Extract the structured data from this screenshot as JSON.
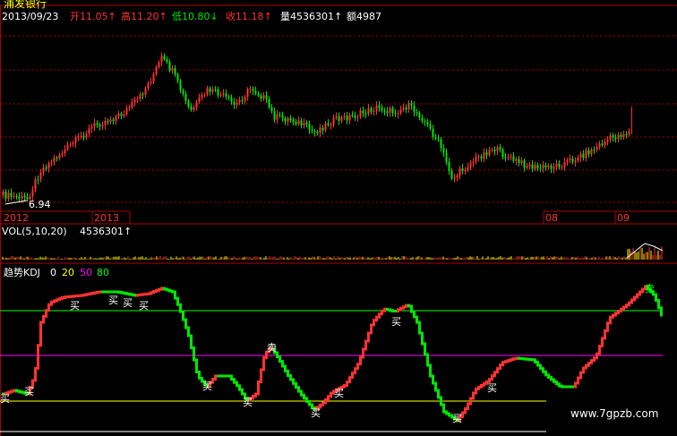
{
  "header": {
    "stock_name": "浦发银行",
    "date": "2013/09/23",
    "open_label": "开11.05↑",
    "high_label": "高11.20↑",
    "low_label": "低10.80↓",
    "close_label": "收11.18↑",
    "volume_label": "量4536301↑",
    "amount_label": "额4987"
  },
  "price_panel": {
    "low_marker": "6.94",
    "years": [
      "2012",
      "2013"
    ],
    "months": [
      "08",
      "09"
    ]
  },
  "volume_panel": {
    "title": "VOL(5,10,20)",
    "value": "4536301↑"
  },
  "kdj_panel": {
    "title": "趋势KDJ",
    "levels": [
      "0",
      "20",
      "50",
      "80"
    ],
    "buy_label": "买",
    "sell_label": "卖"
  },
  "watermark": "www.7gpzb.com",
  "colors": {
    "up": "#ff3232",
    "down": "#00e600",
    "grid": "#aa0000",
    "level_0": "#ffffff",
    "level_20": "#ffff00",
    "level_50": "#ff00ff",
    "level_80": "#00ff00"
  }
}
